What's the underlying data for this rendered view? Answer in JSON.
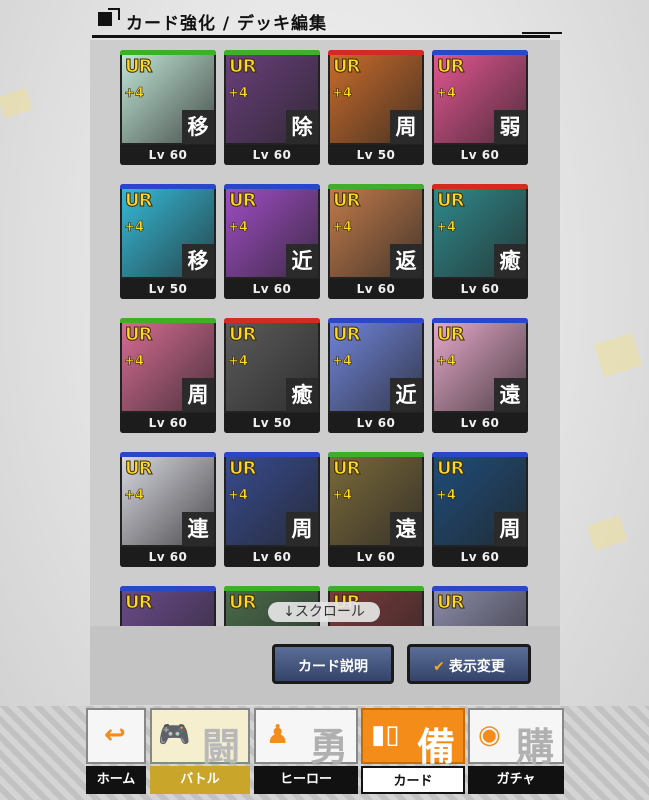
{
  "header": {
    "title": "カード強化 / デッキ編集"
  },
  "cards": [
    {
      "rarity": "UR",
      "plus": "+4",
      "role": "移",
      "level": "Lv 60",
      "frame": "#3fae2a",
      "art": "#bfe4d5"
    },
    {
      "rarity": "UR",
      "plus": "+4",
      "role": "除",
      "level": "Lv 60",
      "frame": "#3fae2a",
      "art": "#6a3f7c"
    },
    {
      "rarity": "UR",
      "plus": "+4",
      "role": "周",
      "level": "Lv 50",
      "frame": "#d42a1f",
      "art": "#c86b2a"
    },
    {
      "rarity": "UR",
      "plus": "+4",
      "role": "弱",
      "level": "Lv 60",
      "frame": "#2a47c8",
      "art": "#e25591"
    },
    {
      "rarity": "UR",
      "plus": "+4",
      "role": "移",
      "level": "Lv 50",
      "frame": "#2a47c8",
      "art": "#35b9d6"
    },
    {
      "rarity": "UR",
      "plus": "+4",
      "role": "近",
      "level": "Lv 60",
      "frame": "#2a47c8",
      "art": "#9f4cc4"
    },
    {
      "rarity": "UR",
      "plus": "+4",
      "role": "返",
      "level": "Lv 60",
      "frame": "#3fae2a",
      "art": "#c07a4a"
    },
    {
      "rarity": "UR",
      "plus": "+4",
      "role": "癒",
      "level": "Lv 60",
      "frame": "#d42a1f",
      "art": "#2f8a8c"
    },
    {
      "rarity": "UR",
      "plus": "+4",
      "role": "周",
      "level": "Lv 60",
      "frame": "#3fae2a",
      "art": "#d66b93"
    },
    {
      "rarity": "UR",
      "plus": "+4",
      "role": "癒",
      "level": "Lv 50",
      "frame": "#d42a1f",
      "art": "#5b5b5b"
    },
    {
      "rarity": "UR",
      "plus": "+4",
      "role": "近",
      "level": "Lv 60",
      "frame": "#2a47c8",
      "art": "#6f83d8"
    },
    {
      "rarity": "UR",
      "plus": "+4",
      "role": "遠",
      "level": "Lv 60",
      "frame": "#2a47c8",
      "art": "#e5a7c8"
    },
    {
      "rarity": "UR",
      "plus": "+4",
      "role": "連",
      "level": "Lv 60",
      "frame": "#2a47c8",
      "art": "#d7d7e0"
    },
    {
      "rarity": "UR",
      "plus": "+4",
      "role": "周",
      "level": "Lv 60",
      "frame": "#2a47c8",
      "art": "#374b8f"
    },
    {
      "rarity": "UR",
      "plus": "+4",
      "role": "遠",
      "level": "Lv 60",
      "frame": "#3fae2a",
      "art": "#7a6a3a"
    },
    {
      "rarity": "UR",
      "plus": "+4",
      "role": "周",
      "level": "Lv 60",
      "frame": "#2a47c8",
      "art": "#1e4d7a"
    },
    {
      "rarity": "UR",
      "plus": "",
      "role": "",
      "level": "",
      "frame": "#2a47c8",
      "art": "#6a4a8a"
    },
    {
      "rarity": "UR",
      "plus": "",
      "role": "",
      "level": "",
      "frame": "#3fae2a",
      "art": "#4a6a4a"
    },
    {
      "rarity": "UR",
      "plus": "",
      "role": "",
      "level": "",
      "frame": "#3fae2a",
      "art": "#7a3a3a"
    },
    {
      "rarity": "UR",
      "plus": "",
      "role": "",
      "level": "",
      "frame": "#2a47c8",
      "art": "#8a8aa8"
    }
  ],
  "scroll_hint": "↓スクロール",
  "buttons": {
    "explain": "カード説明",
    "toggle": "表示変更",
    "toggle_icon": "check-icon"
  },
  "nav": {
    "home": {
      "label": "ホーム",
      "icon": "back-arrow-icon"
    },
    "battle": {
      "label": "バトル",
      "kanji": "闘",
      "icon": "gamepad-icon"
    },
    "hero": {
      "label": "ヒーロー",
      "kanji": "勇",
      "icon": "hero-figure-icon"
    },
    "card": {
      "label": "カード",
      "kanji": "備",
      "icon": "cards-icon"
    },
    "gacha": {
      "label": "ガチャ",
      "kanji": "購",
      "icon": "capsule-icon"
    }
  },
  "colors": {
    "accent": "#f48c1a",
    "button": "#3e4f78",
    "ur_gold": "#ffd928"
  }
}
